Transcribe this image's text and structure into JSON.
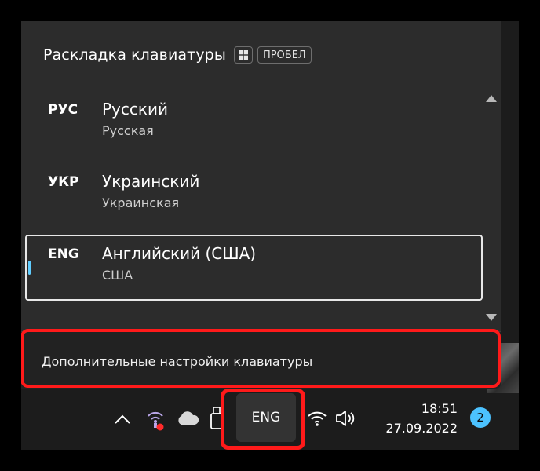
{
  "flyout": {
    "title": "Раскладка клавиатуры",
    "shortcut_key": "ПРОБЕЛ",
    "languages": [
      {
        "code": "РУС",
        "name": "Русский",
        "layout": "Русская",
        "selected": false
      },
      {
        "code": "УКР",
        "name": "Украинский",
        "layout": "Украинская",
        "selected": false
      },
      {
        "code": "ENG",
        "name": "Английский (США)",
        "layout": "США",
        "selected": true
      }
    ],
    "settings_link": "Дополнительные настройки клавиатуры"
  },
  "taskbar": {
    "tray_icons": [
      "chevron-up-icon",
      "network-icon",
      "cloud-icon",
      "usb-icon",
      "wifi-icon",
      "volume-icon"
    ],
    "input_indicator": "ENG",
    "time": "18:51",
    "date": "27.09.2022",
    "notification_count": "2"
  },
  "colors": {
    "accent": "#60cdff",
    "highlight": "#ff1a1a",
    "badge": "#4cc2ff",
    "flyout_bg": "#2c2c2c",
    "taskbar_bg": "#1c1c1c"
  }
}
